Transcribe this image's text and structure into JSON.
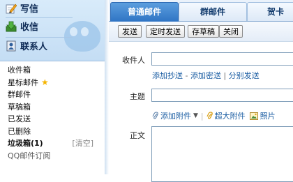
{
  "sidebar": {
    "write_label": "写信",
    "inbox_label": "收信",
    "contacts_label": "联系人",
    "folders": [
      {
        "label": "收件箱"
      },
      {
        "label": "星标邮件",
        "star": true
      },
      {
        "label": "群邮件"
      },
      {
        "label": "草稿箱"
      },
      {
        "label": "已发送"
      },
      {
        "label": "已删除"
      },
      {
        "label": "垃圾箱(1)",
        "action": "[清空]"
      },
      {
        "label": "QQ邮件订阅"
      }
    ]
  },
  "tabs": [
    "普通邮件",
    "群邮件",
    "贺卡"
  ],
  "toolbar": {
    "send": "发送",
    "timed_send": "定时发送",
    "save_draft": "存草稿",
    "close": "关闭"
  },
  "compose": {
    "to_label": "收件人",
    "add_cc": "添加抄送",
    "dash": " - ",
    "add_bcc": "添加密送",
    "pipe": " | ",
    "separate_send": "分别发送",
    "subject_label": "主题",
    "add_attachment": "添加附件",
    "large_attachment": "超大附件",
    "photo": "照片",
    "body_label": "正文"
  },
  "colors": {
    "accent": "#2f74c4",
    "link": "#1c5ea3",
    "star": "#f5b400"
  }
}
